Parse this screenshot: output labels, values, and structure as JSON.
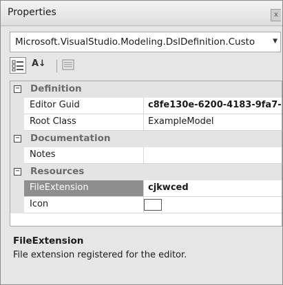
{
  "window": {
    "title": "Properties",
    "close_glyph": "x"
  },
  "selector": {
    "value": "Microsoft.VisualStudio.Modeling.DslDefinition.Custo",
    "arrow": "▼"
  },
  "toolbar": {
    "buttons": [
      "categorized-view",
      "alphabetical-view",
      "property-pages"
    ],
    "alpha_glyph": "A↓"
  },
  "grid": {
    "categories": {
      "definition": {
        "toggle": "−",
        "label": "Definition"
      },
      "documentation": {
        "toggle": "−",
        "label": "Documentation"
      },
      "resources": {
        "toggle": "−",
        "label": "Resources"
      }
    },
    "properties": {
      "editor_guid": {
        "name": "Editor Guid",
        "value": "c8fe130e-6200-4183-9fa7-"
      },
      "root_class": {
        "name": "Root Class",
        "value": "ExampleModel"
      },
      "notes": {
        "name": "Notes",
        "value": ""
      },
      "file_extension": {
        "name": "FileExtension",
        "value": "cjkwced"
      },
      "icon": {
        "name": "Icon",
        "value": ""
      }
    }
  },
  "description": {
    "title": "FileExtension",
    "text": "File extension registered for the editor."
  },
  "colors": {
    "selected_row": "#8e8e8e",
    "category_bg": "#e4e4e4"
  }
}
